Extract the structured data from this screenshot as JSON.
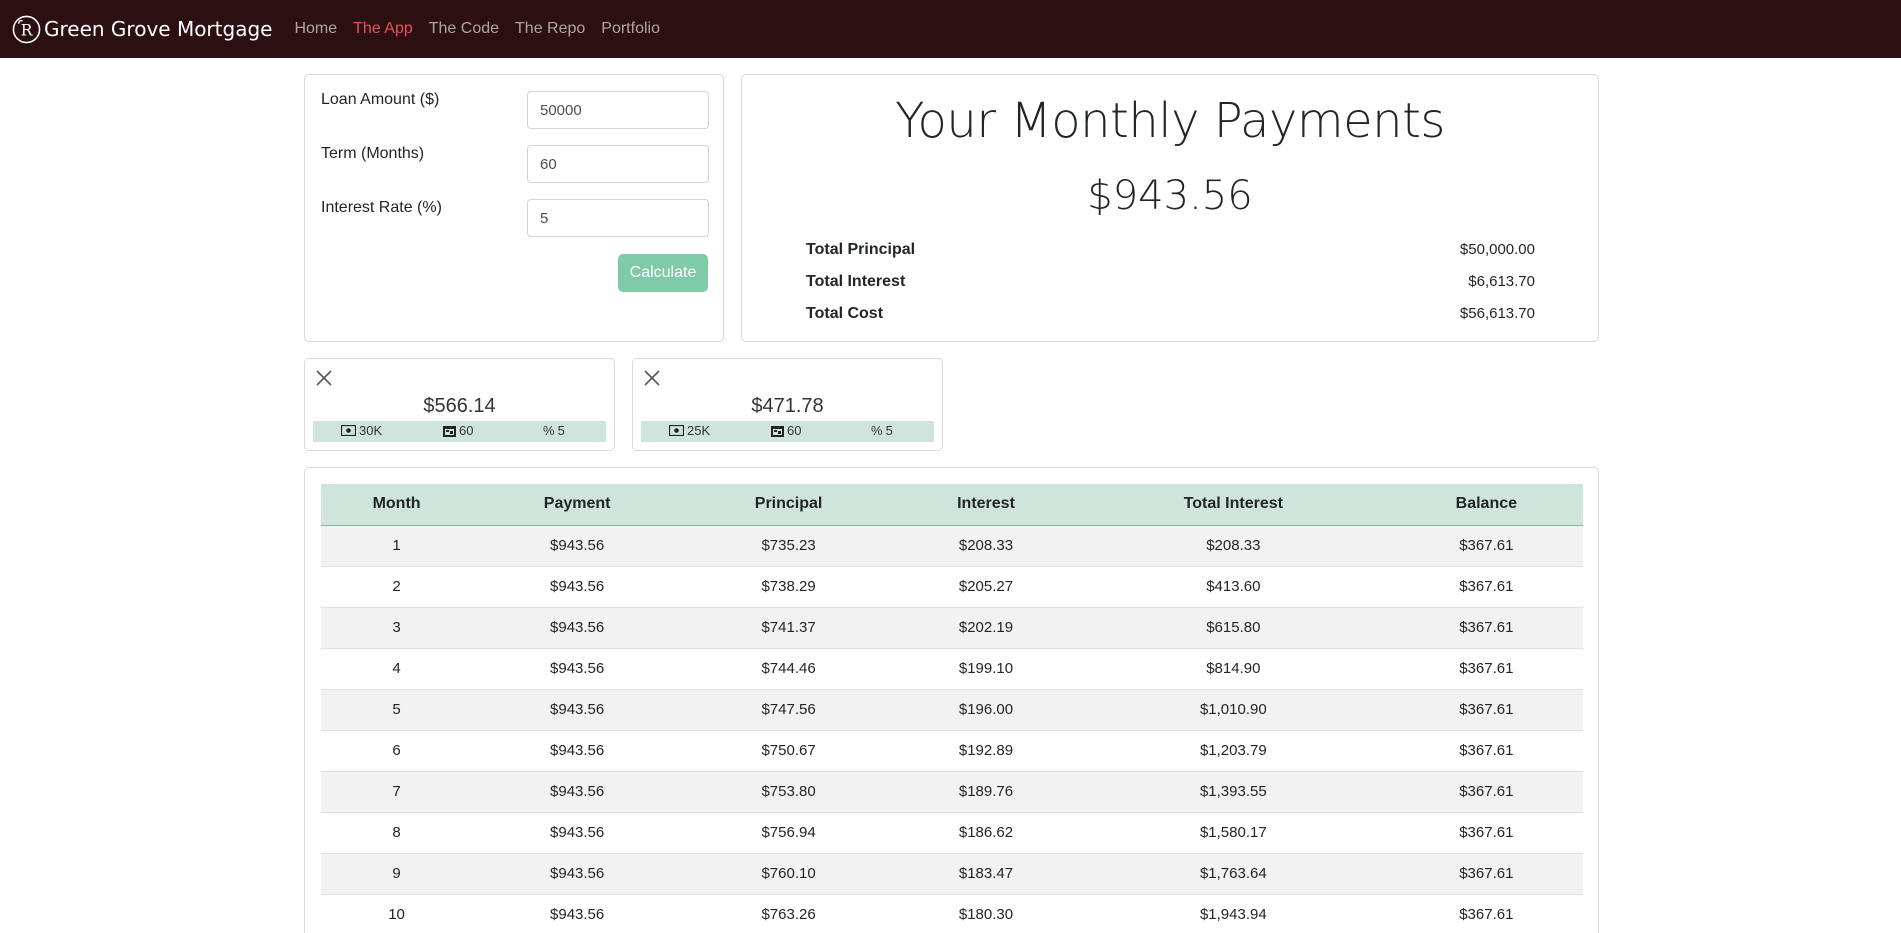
{
  "navbar": {
    "brand": "Green Grove Mortgage",
    "links": [
      {
        "label": "Home",
        "active": false
      },
      {
        "label": "The App",
        "active": true
      },
      {
        "label": "The Code",
        "active": false
      },
      {
        "label": "The Repo",
        "active": false
      },
      {
        "label": "Portfolio",
        "active": false
      }
    ]
  },
  "form": {
    "loan_amount_label": "Loan Amount ($)",
    "loan_amount_value": "50000",
    "term_label": "Term (Months)",
    "term_value": "60",
    "rate_label": "Interest Rate (%)",
    "rate_value": "5",
    "calculate_label": "Calculate"
  },
  "results": {
    "title": "Your Monthly Payments",
    "monthly_payment": "$943.56",
    "total_principal_label": "Total Principal",
    "total_principal": "$50,000.00",
    "total_interest_label": "Total Interest",
    "total_interest": "$6,613.70",
    "total_cost_label": "Total Cost",
    "total_cost": "$56,613.70"
  },
  "saved": [
    {
      "amount": "$566.14",
      "loan": "30K",
      "term": "60",
      "rate": "5"
    },
    {
      "amount": "$471.78",
      "loan": "25K",
      "term": "60",
      "rate": "5"
    }
  ],
  "table": {
    "headers": [
      "Month",
      "Payment",
      "Principal",
      "Interest",
      "Total Interest",
      "Balance"
    ],
    "rows": [
      [
        "1",
        "$943.56",
        "$735.23",
        "$208.33",
        "$208.33",
        "$367.61"
      ],
      [
        "2",
        "$943.56",
        "$738.29",
        "$205.27",
        "$413.60",
        "$367.61"
      ],
      [
        "3",
        "$943.56",
        "$741.37",
        "$202.19",
        "$615.80",
        "$367.61"
      ],
      [
        "4",
        "$943.56",
        "$744.46",
        "$199.10",
        "$814.90",
        "$367.61"
      ],
      [
        "5",
        "$943.56",
        "$747.56",
        "$196.00",
        "$1,010.90",
        "$367.61"
      ],
      [
        "6",
        "$943.56",
        "$750.67",
        "$192.89",
        "$1,203.79",
        "$367.61"
      ],
      [
        "7",
        "$943.56",
        "$753.80",
        "$189.76",
        "$1,393.55",
        "$367.61"
      ],
      [
        "8",
        "$943.56",
        "$756.94",
        "$186.62",
        "$1,580.17",
        "$367.61"
      ],
      [
        "9",
        "$943.56",
        "$760.10",
        "$183.47",
        "$1,763.64",
        "$367.61"
      ],
      [
        "10",
        "$943.56",
        "$763.26",
        "$180.30",
        "$1,943.94",
        "$367.61"
      ]
    ]
  },
  "colors": {
    "navbar_bg": "#2c0f10",
    "active_link": "#e8525a",
    "accent_green": "#7fcaa8",
    "table_header_bg": "#cfe5dc"
  },
  "icons": {
    "brand": "brand-logo-icon",
    "close": "close-icon",
    "loan": "cash-icon",
    "term": "calendar-icon",
    "rate": "percent-icon"
  }
}
